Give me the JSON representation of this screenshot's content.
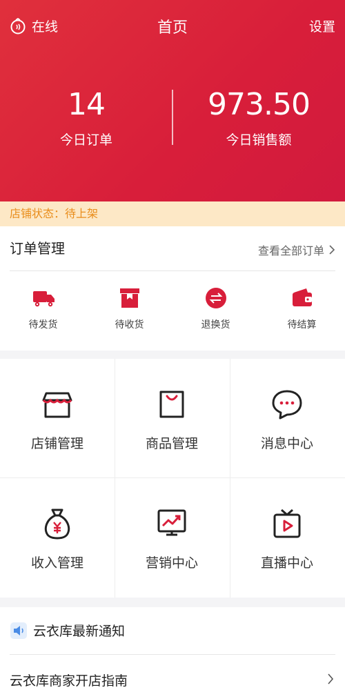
{
  "topbar": {
    "online_label": "在线",
    "title": "首页",
    "settings_label": "设置"
  },
  "stats": {
    "orders_today": {
      "value": "14",
      "label": "今日订单"
    },
    "sales_today": {
      "value": "973.50",
      "label": "今日销售额"
    }
  },
  "shop_status": "店铺状态：待上架",
  "orders": {
    "title": "订单管理",
    "view_all": "查看全部订单",
    "items": [
      {
        "label": "待发货",
        "icon": "truck-icon"
      },
      {
        "label": "待收货",
        "icon": "box-icon"
      },
      {
        "label": "退换货",
        "icon": "exchange-icon"
      },
      {
        "label": "待结算",
        "icon": "wallet-icon"
      }
    ]
  },
  "grid": [
    {
      "label": "店铺管理",
      "icon": "store-icon"
    },
    {
      "label": "商品管理",
      "icon": "shopping-bag-icon"
    },
    {
      "label": "消息中心",
      "icon": "chat-bubble-icon"
    },
    {
      "label": "收入管理",
      "icon": "money-bag-icon"
    },
    {
      "label": "营销中心",
      "icon": "trend-chart-icon"
    },
    {
      "label": "直播中心",
      "icon": "tv-play-icon"
    }
  ],
  "notice": {
    "title": "云衣库最新通知",
    "guide": "云衣库商家开店指南"
  },
  "colors": {
    "primary_red": "#d81e3a",
    "status_bg": "#fde8c6",
    "status_text": "#e98d1b"
  }
}
